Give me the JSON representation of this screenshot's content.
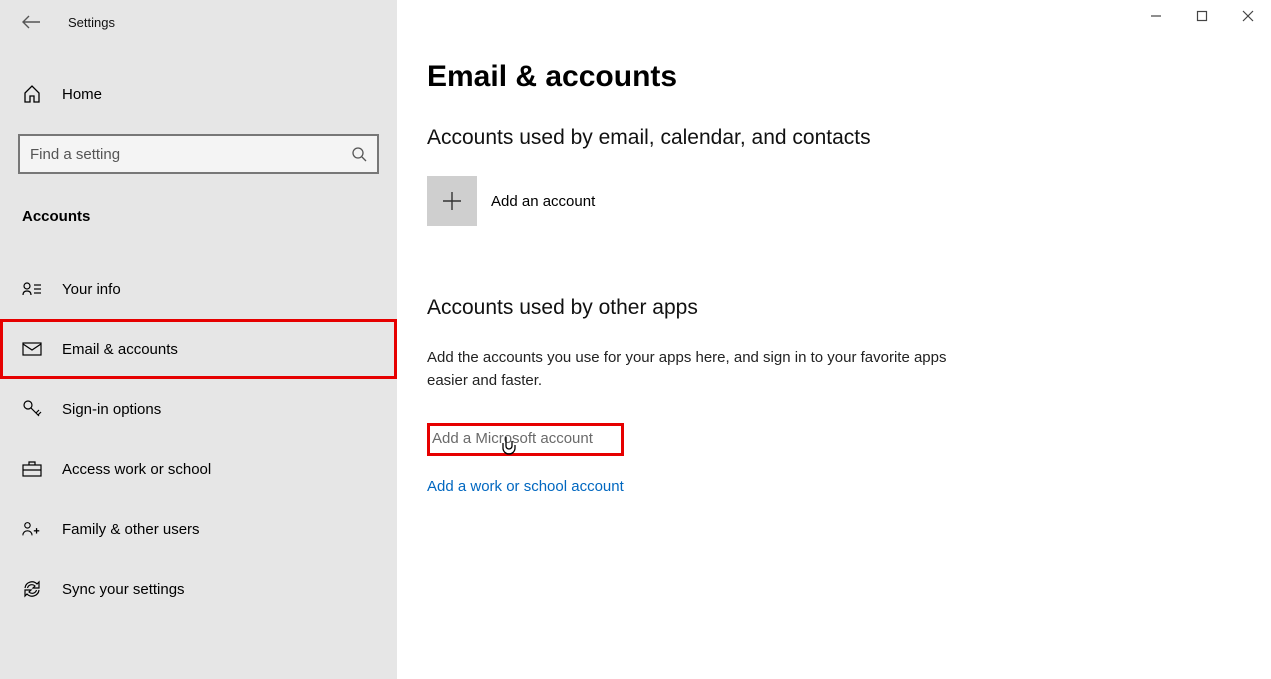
{
  "app_title": "Settings",
  "home_label": "Home",
  "search_placeholder": "Find a setting",
  "category_label": "Accounts",
  "nav": [
    {
      "label": "Your info"
    },
    {
      "label": "Email & accounts"
    },
    {
      "label": "Sign-in options"
    },
    {
      "label": "Access work or school"
    },
    {
      "label": "Family & other users"
    },
    {
      "label": "Sync your settings"
    }
  ],
  "page_title": "Email & accounts",
  "section1_heading": "Accounts used by email, calendar, and contacts",
  "add_account_label": "Add an account",
  "section2_heading": "Accounts used by other apps",
  "section2_desc": "Add the accounts you use for your apps here, and sign in to your favorite apps easier and faster.",
  "link_ms": "Add a Microsoft account",
  "link_work": "Add a work or school account"
}
